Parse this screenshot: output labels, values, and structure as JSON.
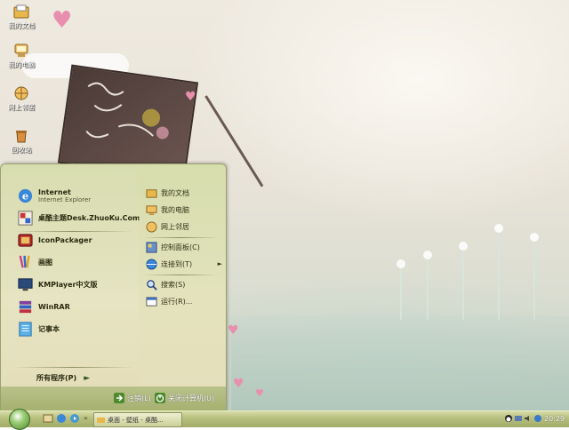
{
  "desktop": {
    "icons": [
      {
        "label": "我的文档",
        "icon": "folder-icon"
      },
      {
        "label": "我的电脑",
        "icon": "computer-icon"
      },
      {
        "label": "网上邻居",
        "icon": "network-icon"
      },
      {
        "label": "回收站",
        "icon": "recycle-bin-icon"
      }
    ]
  },
  "start_menu": {
    "pinned": [
      {
        "title": "Internet",
        "subtitle": "Internet Explorer",
        "icon": "ie-icon"
      },
      {
        "title": "桌酷主题Desk.ZhuoKu.Com",
        "icon": "zhuoku-icon"
      }
    ],
    "recent": [
      {
        "title": "IconPackager",
        "icon": "iconpackager-icon"
      },
      {
        "title": "画图",
        "icon": "paint-icon"
      },
      {
        "title": "KMPlayer中文版",
        "icon": "kmplayer-icon"
      },
      {
        "title": "WinRAR",
        "icon": "winrar-icon"
      },
      {
        "title": "记事本",
        "icon": "notepad-icon"
      }
    ],
    "all_programs": "所有程序(P)",
    "places": [
      {
        "label": "我的文档",
        "icon": "folder-icon"
      },
      {
        "label": "我的电脑",
        "icon": "computer-icon"
      },
      {
        "label": "网上邻居",
        "icon": "network-icon"
      }
    ],
    "system": [
      {
        "label": "控制面板(C)",
        "icon": "control-panel-icon"
      },
      {
        "label": "连接到(T)",
        "icon": "connect-icon",
        "submenu": true
      }
    ],
    "tools": [
      {
        "label": "搜索(S)",
        "icon": "search-icon"
      },
      {
        "label": "运行(R)...",
        "icon": "run-icon"
      }
    ],
    "logoff": "注销(L)",
    "shutdown": "关闭计算机(U)"
  },
  "taskbar": {
    "task": "桌面 - 壁纸 - 桌酷...",
    "clock": "20:29"
  },
  "colors": {
    "taskbar": "#b8c07e",
    "menu_bg": "#e6e4c2",
    "accent_green": "#4e8a2e"
  }
}
